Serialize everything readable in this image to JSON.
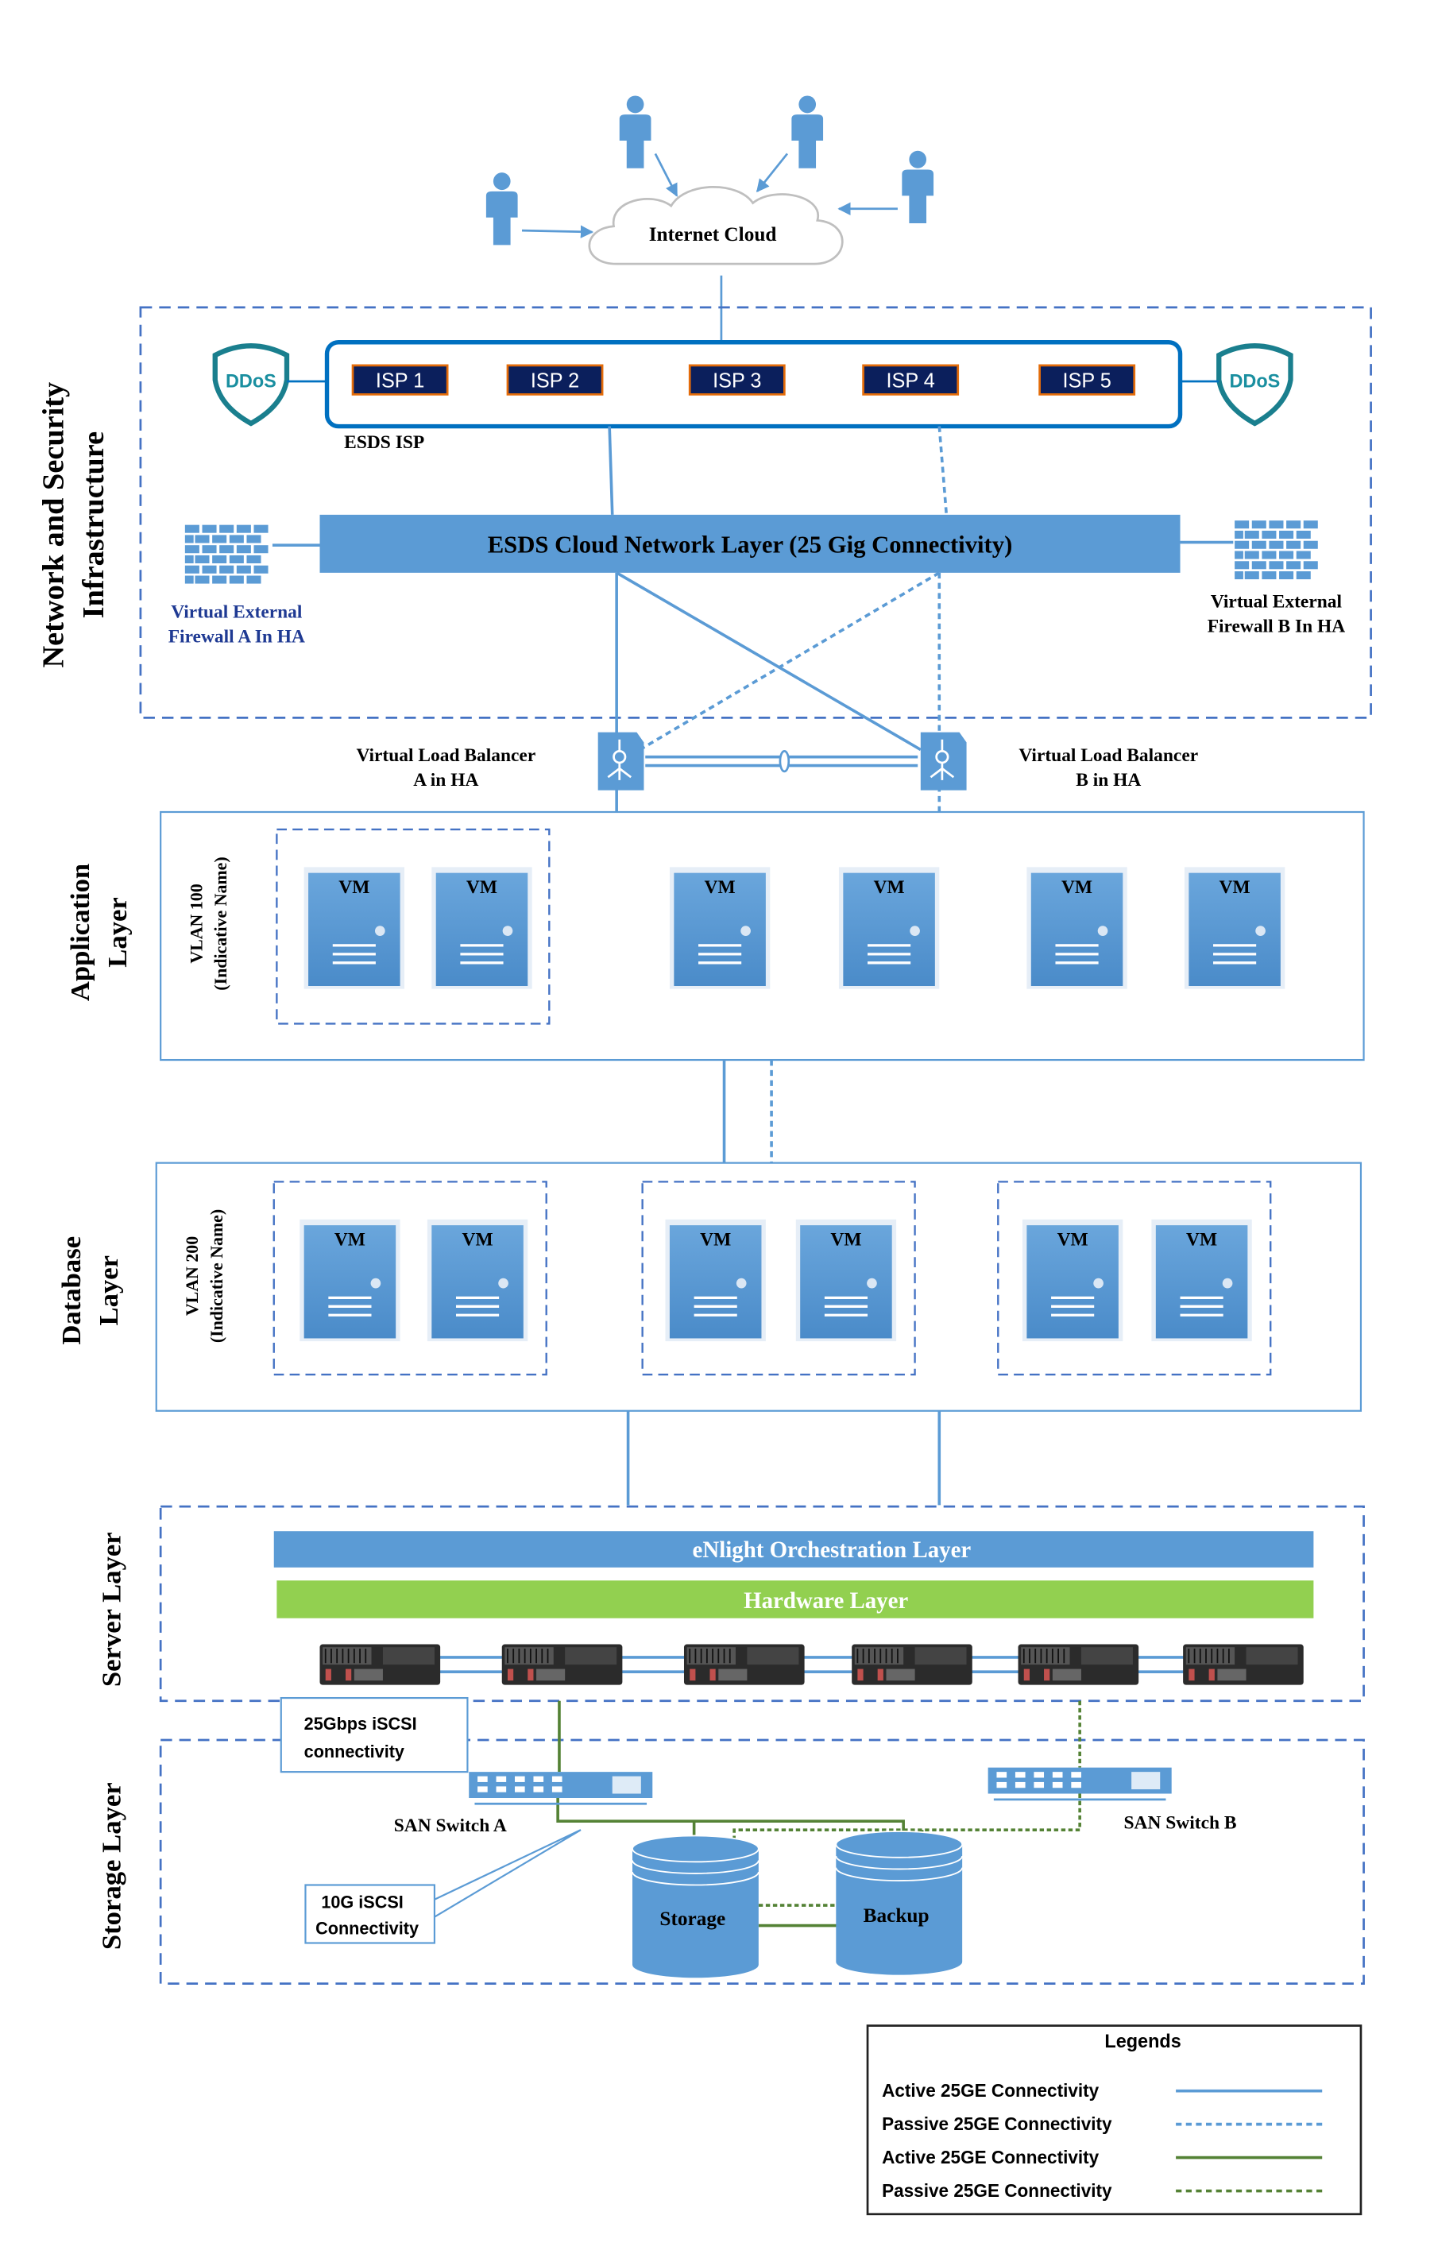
{
  "colors": {
    "blue": "#5b9bd5",
    "dark_blue": "#0070c0",
    "navy": "#0b1f5c",
    "green": "#92d050",
    "line_green": "#548235",
    "isp_border": "#e46c0a"
  },
  "internet": {
    "label": "Internet Cloud"
  },
  "network_layer": {
    "title_line1": "Network and Security",
    "title_line2": "Infrastructure",
    "isp_group_label": "ESDS ISP",
    "isps": [
      "ISP 1",
      "ISP 2",
      "ISP 3",
      "ISP 4",
      "ISP 5"
    ],
    "ddos_label": "DDoS",
    "cloud_network": "ESDS  Cloud Network Layer (25 Gig Connectivity)",
    "firewall_a": [
      "Virtual External",
      "Firewall A In HA"
    ],
    "firewall_b": [
      "Virtual External",
      "Firewall B In HA"
    ]
  },
  "load_balancers": {
    "a": [
      "Virtual Load Balancer",
      "A in HA"
    ],
    "b": [
      "Virtual Load Balancer",
      "B in HA"
    ]
  },
  "application_layer": {
    "title_line1": "Application",
    "title_line2": "Layer",
    "vlan_line1": "VLAN 100",
    "vlan_line2": "(Indicative Name)",
    "vm_label": "VM"
  },
  "database_layer": {
    "title_line1": "Database",
    "title_line2": "Layer",
    "vlan_line1": "VLAN 200",
    "vlan_line2": "(Indicative Name)",
    "vm_label": "VM"
  },
  "server_layer": {
    "title": "Server Layer",
    "orchestration": "eNlight Orchestration Layer",
    "hardware": "Hardware Layer"
  },
  "storage_layer": {
    "title": "Storage Layer",
    "callout_25g": [
      "25Gbps iSCSI",
      "connectivity"
    ],
    "callout_10g": [
      "10G iSCSI",
      "Connectivity"
    ],
    "san_a": "SAN Switch A",
    "san_b": "SAN Switch B",
    "storage": "Storage",
    "backup": "Backup"
  },
  "legend": {
    "title": "Legends",
    "items": [
      {
        "label": "Active 25GE Connectivity",
        "color": "#5b9bd5",
        "style": "solid"
      },
      {
        "label": "Passive 25GE Connectivity",
        "color": "#5b9bd5",
        "style": "dashed"
      },
      {
        "label": "Active 25GE Connectivity",
        "color": "#548235",
        "style": "solid"
      },
      {
        "label": "Passive 25GE Connectivity",
        "color": "#548235",
        "style": "dashed"
      }
    ]
  }
}
